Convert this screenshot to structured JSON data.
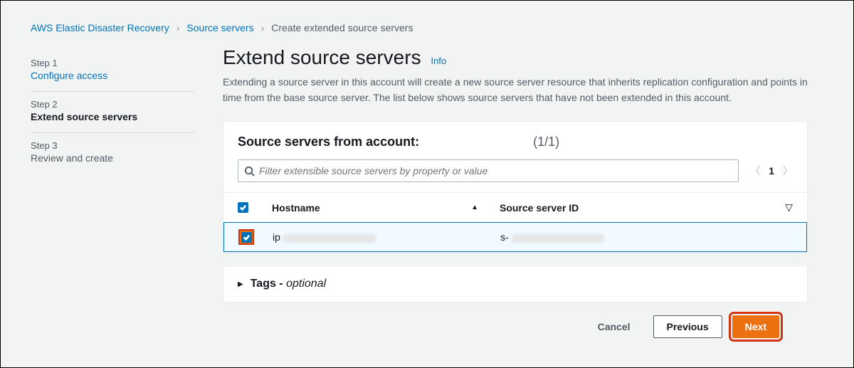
{
  "breadcrumb": {
    "service": "AWS Elastic Disaster Recovery",
    "section": "Source servers",
    "current": "Create extended source servers"
  },
  "wizard": {
    "step1_number": "Step 1",
    "step1_title": "Configure access",
    "step2_number": "Step 2",
    "step2_title": "Extend source servers",
    "step3_number": "Step 3",
    "step3_title": "Review and create"
  },
  "heading": {
    "title": "Extend source servers",
    "info": "Info",
    "description": "Extending a source server in this account will create a new source server resource that inherits replication configuration and points in time from the base source server. The list below shows source servers that have not been extended in this account."
  },
  "panel": {
    "title": "Source servers from account:",
    "count": "(1/1)",
    "search_placeholder": "Filter extensible source servers by property or value",
    "page": "1",
    "columns": {
      "hostname": "Hostname",
      "source_id": "Source server ID"
    },
    "sort_indicator_up": "▲",
    "gear_icon": "▽",
    "rows": [
      {
        "hostname_prefix": "ip",
        "source_id_prefix": "s-"
      }
    ]
  },
  "tags": {
    "label_a": "Tags - ",
    "label_b": "optional",
    "caret": "▶"
  },
  "buttons": {
    "cancel": "Cancel",
    "previous": "Previous",
    "next": "Next"
  }
}
